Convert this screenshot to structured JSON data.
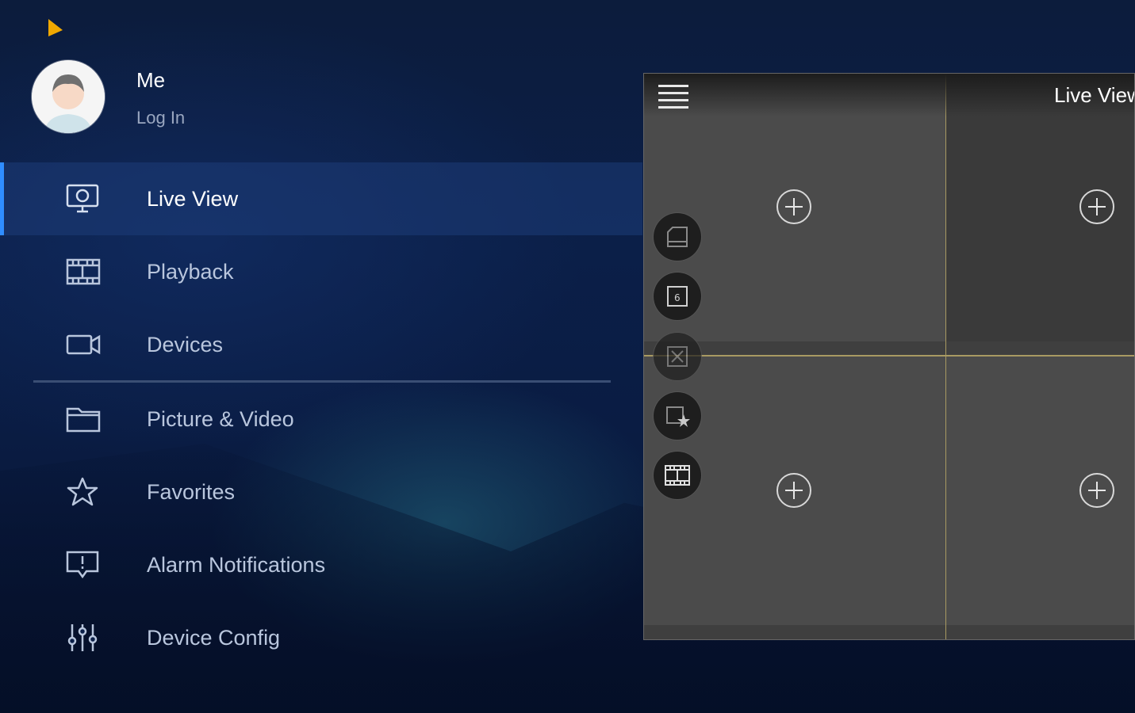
{
  "profile": {
    "name": "Me",
    "login": "Log In"
  },
  "menu": {
    "items": [
      {
        "label": "Live View",
        "icon": "monitor-icon",
        "active": true
      },
      {
        "label": "Playback",
        "icon": "film-strip-icon"
      },
      {
        "label": "Devices",
        "icon": "video-camera-icon"
      },
      {
        "label": "Picture & Video",
        "icon": "folder-icon"
      },
      {
        "label": "Favorites",
        "icon": "star-icon"
      },
      {
        "label": "Alarm Notifications",
        "icon": "alarm-message-icon"
      },
      {
        "label": "Device Config",
        "icon": "sliders-icon"
      }
    ]
  },
  "preview": {
    "title": "Live View",
    "grid_cells": 4,
    "side_controls": [
      "snapshot-icon",
      "stream-6-icon",
      "close-window-icon",
      "add-favorite-icon",
      "record-film-icon"
    ]
  },
  "colors": {
    "accent": "#2f8dff",
    "grid_line": "#a99a62",
    "cursor": "#f0a800"
  }
}
